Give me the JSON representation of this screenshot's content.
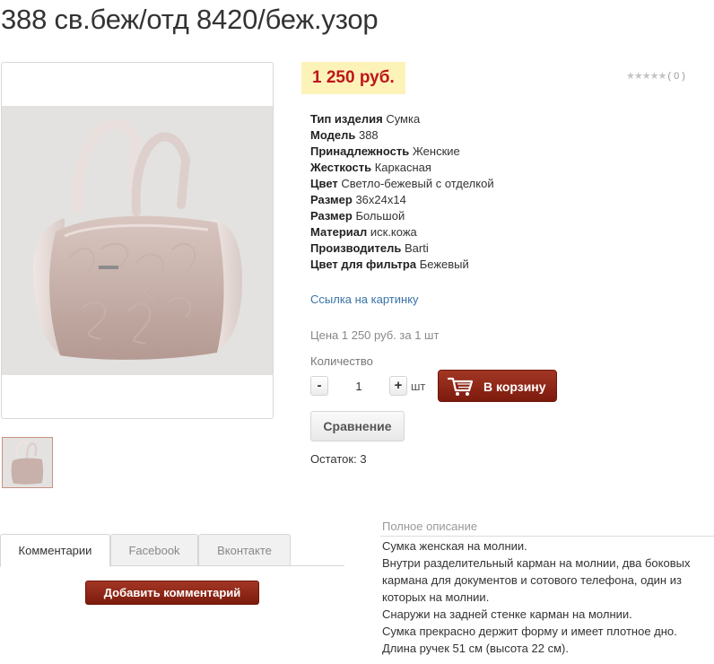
{
  "product": {
    "title": "388 св.беж/отд 8420/беж.узор",
    "price": "1 250 руб.",
    "rating_stars": "★★★★★",
    "rating_count": "( 0 )",
    "image_alt": "Сумка"
  },
  "properties": [
    {
      "label": "Тип изделия",
      "value": "Сумка"
    },
    {
      "label": "Модель",
      "value": "388"
    },
    {
      "label": "Принадлежность",
      "value": "Женские"
    },
    {
      "label": "Жесткость",
      "value": "Каркасная"
    },
    {
      "label": "Цвет",
      "value": "Светло-бежевый с отделкой"
    },
    {
      "label": "Размер",
      "value": "36x24x14"
    },
    {
      "label": "Размер",
      "value": "Большой"
    },
    {
      "label": "Материал",
      "value": "иск.кожа"
    },
    {
      "label": "Производитель",
      "value": "Barti"
    },
    {
      "label": "Цвет для фильтра",
      "value": "Бежевый"
    }
  ],
  "image_link": "Ссылка на картинку",
  "price_per_unit": "Цена 1 250 руб. за 1 шт",
  "quantity": {
    "label": "Количество",
    "minus": "-",
    "plus": "+",
    "value": "1",
    "unit": "шт"
  },
  "buttons": {
    "add_to_cart": "В корзину",
    "compare": "Сравнение",
    "add_comment": "Добавить комментарий"
  },
  "stock": "Остаток: 3",
  "tabs": [
    {
      "label": "Комментарии",
      "active": true
    },
    {
      "label": "Facebook",
      "active": false
    },
    {
      "label": "Вконтакте",
      "active": false
    }
  ],
  "description": {
    "title": "Полное описание",
    "lines": [
      "Сумка женская на молнии.",
      "Внутри разделительный карман на молнии, два боковых кармана для документов и сотового телефона, один из которых на молнии.",
      "Снаружи на задней стенке карман на молнии.",
      "Сумка прекрасно держит форму и имеет плотное дно.",
      "Длина ручек 51 см (высота 22 см)."
    ]
  },
  "colors": {
    "price_text": "#c0151b",
    "price_bg": "#fdf3b8",
    "accent_button": "#8e2616",
    "link": "#3a73a8"
  }
}
